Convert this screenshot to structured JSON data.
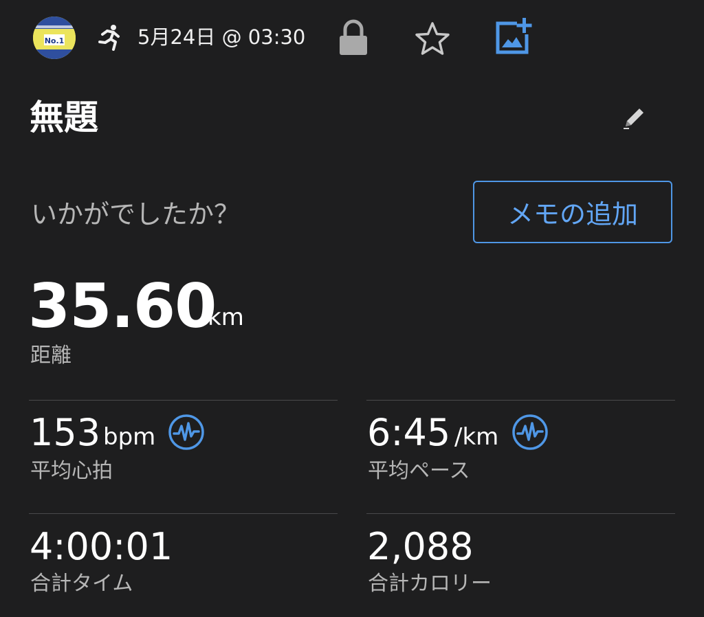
{
  "header": {
    "avatar_icon": "race-bib-no1-avatar",
    "activity_icon": "running-icon",
    "datetime": "5月24日 @ 03:30",
    "lock_icon": "lock-icon",
    "favorite_icon": "star-icon",
    "add_photo_icon": "add-photo-icon",
    "accent_color": "#4f97e6"
  },
  "activity": {
    "title": "無題",
    "edit_icon": "pencil-icon"
  },
  "feedback": {
    "prompt": "いかがでしたか？",
    "memo_button_label": "メモの追加"
  },
  "distance": {
    "value": "35.60",
    "unit": "km",
    "label": "距離"
  },
  "stats": {
    "heart_rate": {
      "value": "153",
      "unit": "bpm",
      "label": "平均心拍",
      "icon": "heart-rate-icon"
    },
    "pace": {
      "value": "6:45",
      "unit": "/km",
      "label": "平均ペース",
      "icon": "heart-rate-icon"
    },
    "time": {
      "value": "4:00:01",
      "label": "合計タイム"
    },
    "calories": {
      "value": "2,088",
      "label": "合計カロリー"
    }
  }
}
